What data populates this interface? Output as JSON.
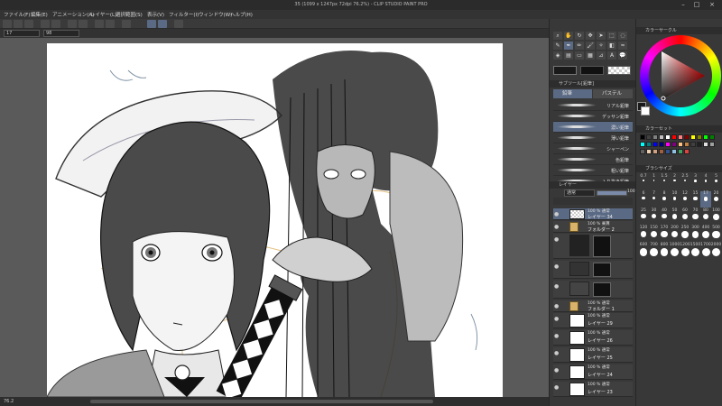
{
  "app": {
    "title": "35 (1099 x 1247px 72dpi 76.2%)  - CLIP STUDIO PAINT PRO"
  },
  "menu": [
    "ファイル(F)",
    "編集(E)",
    "アニメーション(A)",
    "レイヤー(L)",
    "選択範囲(S)",
    "表示(V)",
    "フィルター(I)",
    "ウィンドウ(W)",
    "ヘルプ(H)"
  ],
  "tooloptions": {
    "size_value": "17",
    "opacity_value": "98"
  },
  "status": {
    "zoom": "76.2"
  },
  "subtool": {
    "header": "サブツール[鉛筆]",
    "tabs": [
      "鉛筆",
      "パステル"
    ],
    "brushes": [
      "リアル鉛筆",
      "デッサン鉛筆",
      "濃い鉛筆",
      "薄い鉛筆",
      "シャーペン",
      "色鉛筆",
      "粗い鉛筆",
      "入り抜き鉛筆"
    ],
    "selected_index": 2
  },
  "color_wheel": {
    "header": "カラーサークル",
    "main_color": "#1a1a1a",
    "sub_color": "#ffffff"
  },
  "color_set": {
    "header": "カラーセット"
  },
  "brush_size": {
    "header": "ブラシサイズ",
    "sizes": [
      "0.7",
      "1",
      "1.5",
      "2",
      "2.5",
      "3",
      "4",
      "5",
      "6",
      "7",
      "8",
      "10",
      "12",
      "15",
      "17",
      "20",
      "25",
      "30",
      "40",
      "50",
      "60",
      "70",
      "80",
      "100",
      "120",
      "150",
      "170",
      "200",
      "250",
      "300",
      "400",
      "500",
      "600",
      "700",
      "800",
      "1000",
      "1200",
      "1500",
      "1700",
      "2000"
    ],
    "selected": "17"
  },
  "layers": {
    "header": "レイヤー",
    "blend_mode": "通常",
    "opacity": "100",
    "items": [
      {
        "mode": "100 % 通常",
        "name": "レイヤー 34",
        "selected": true,
        "kind": "layer"
      },
      {
        "mode": "100 % 乗算",
        "name": "フォルダー 2",
        "selected": false,
        "kind": "folder"
      },
      {
        "mode": "",
        "name": "",
        "selected": false,
        "kind": "mask"
      },
      {
        "mode": "",
        "name": "",
        "selected": false,
        "kind": "mask"
      },
      {
        "mode": "",
        "name": "",
        "selected": false,
        "kind": "mask"
      },
      {
        "mode": "100 % 通常",
        "name": "フォルダー 1",
        "selected": false,
        "kind": "folder"
      },
      {
        "mode": "100 % 通常",
        "name": "レイヤー 29",
        "selected": false,
        "kind": "layer"
      },
      {
        "mode": "100 % 通常",
        "name": "レイヤー 26",
        "selected": false,
        "kind": "layer"
      },
      {
        "mode": "100 % 通常",
        "name": "レイヤー 25",
        "selected": false,
        "kind": "layer"
      },
      {
        "mode": "100 % 通常",
        "name": "レイヤー 24",
        "selected": false,
        "kind": "layer"
      },
      {
        "mode": "100 % 通常",
        "name": "レイヤー 23",
        "selected": false,
        "kind": "layer"
      }
    ]
  }
}
